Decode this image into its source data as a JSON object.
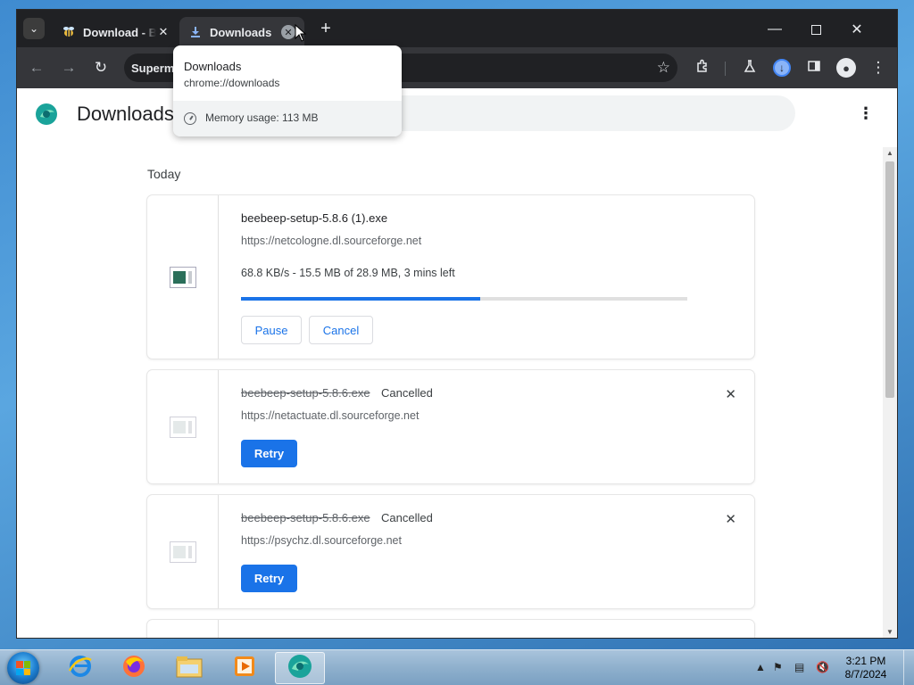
{
  "browser": {
    "tabs": [
      {
        "label": "Download - B",
        "active": false
      },
      {
        "label": "Downloads",
        "active": true
      }
    ],
    "omnibox_text": "Supermi",
    "hovercard": {
      "title": "Downloads",
      "url": "chrome://downloads",
      "memory": "Memory usage: 113 MB"
    }
  },
  "page": {
    "title": "Downloads",
    "section": "Today",
    "items": [
      {
        "filename": "beebeep-setup-5.8.6 (1).exe",
        "url": "https://netcologne.dl.sourceforge.net",
        "progress_text": "68.8 KB/s - 15.5 MB of 28.9 MB, 3 mins left",
        "progress_fraction": 0.536,
        "pause_label": "Pause",
        "cancel_label": "Cancel"
      },
      {
        "filename": "beebeep-setup-5.8.6.exe",
        "status": "Cancelled",
        "url": "https://netactuate.dl.sourceforge.net",
        "retry_label": "Retry"
      },
      {
        "filename": "beebeep-setup-5.8.6.exe",
        "status": "Cancelled",
        "url": "https://psychz.dl.sourceforge.net",
        "retry_label": "Retry"
      }
    ]
  },
  "taskbar": {
    "time": "3:21 PM",
    "date": "8/7/2024"
  },
  "colors": {
    "accent": "#1a73e8",
    "chrome_dark": "#202124",
    "toolbar": "#35363a"
  }
}
